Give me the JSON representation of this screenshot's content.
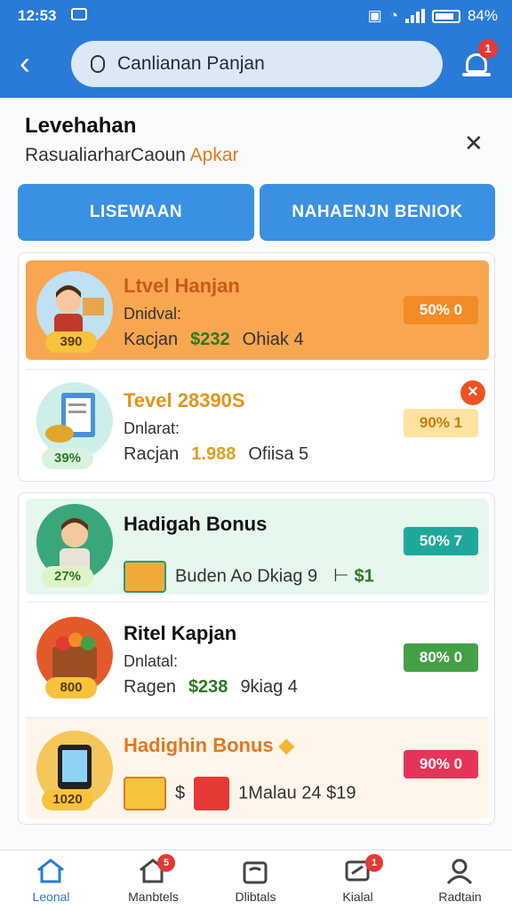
{
  "status": {
    "time": "12:53",
    "battery": "84%"
  },
  "search": {
    "value": "Canlianan Panjan"
  },
  "notifications": {
    "badge": "1"
  },
  "section": {
    "title": "Levehahan",
    "subtitle_main": "RasualiarharCaoun",
    "subtitle_accent": "Apkar"
  },
  "tabs": [
    {
      "label": "LISEWAAN"
    },
    {
      "label": "NAHAENJN BENIOK"
    }
  ],
  "items": [
    {
      "title": "Ltvel Hanjan",
      "label": "Dnidval:",
      "prefix": "Kacjan",
      "amount": "$232",
      "suffix": "Ohiak 4",
      "pill": "50% 0",
      "chip": "390",
      "title_color": "#c9591a",
      "pill_bg": "#f28c26",
      "pill_fg": "#fff",
      "row_bg": "#f9a650",
      "amount_color": "#2a7a23"
    },
    {
      "title": "Tevel 28390S",
      "label": "Dnlarat:",
      "prefix": "Racjan",
      "amount": "1.988",
      "suffix": "Ofiisa 5",
      "pill": "90% 1",
      "chip": "39%",
      "title_color": "#e0951a",
      "pill_bg": "#fde3a0",
      "pill_fg": "#c97a12",
      "row_bg": "#ffffff",
      "amount_color": "#d8a21b"
    },
    {
      "title": "Hadigah Bonus",
      "label": "",
      "prefix": "Buden Ao Dkiag 9",
      "amount": "",
      "suffix": "$1",
      "pill": "50% 7",
      "chip": "27%",
      "title_color": "#111",
      "pill_bg": "#1ea89b",
      "pill_fg": "#fff",
      "row_bg": "#e6f7ee",
      "amount_color": "#2a7a23"
    },
    {
      "title": "Ritel Kapjan",
      "label": "Dnlatal:",
      "prefix": "Ragen",
      "amount": "$238",
      "suffix": "9kiag 4",
      "pill": "80% 0",
      "chip": "800",
      "title_color": "#111",
      "pill_bg": "#43a047",
      "pill_fg": "#fff",
      "row_bg": "#ffffff",
      "amount_color": "#2a7a23"
    },
    {
      "title": "Hadighin Bonus",
      "label": "",
      "prefix": "$",
      "amount": "",
      "suffix": "1Malau 24   $19",
      "pill": "90% 0",
      "chip": "1020",
      "title_color": "#e07a1f",
      "pill_bg": "#e5345a",
      "pill_fg": "#fff",
      "row_bg": "#fff5ea",
      "amount_color": "#2a7a23"
    }
  ],
  "nav": [
    {
      "label": "Leonal",
      "active": true
    },
    {
      "label": "Manbtels",
      "badge": "5"
    },
    {
      "label": "Dlibtals"
    },
    {
      "label": "Kialal",
      "badge": "1"
    },
    {
      "label": "Radtain"
    }
  ]
}
